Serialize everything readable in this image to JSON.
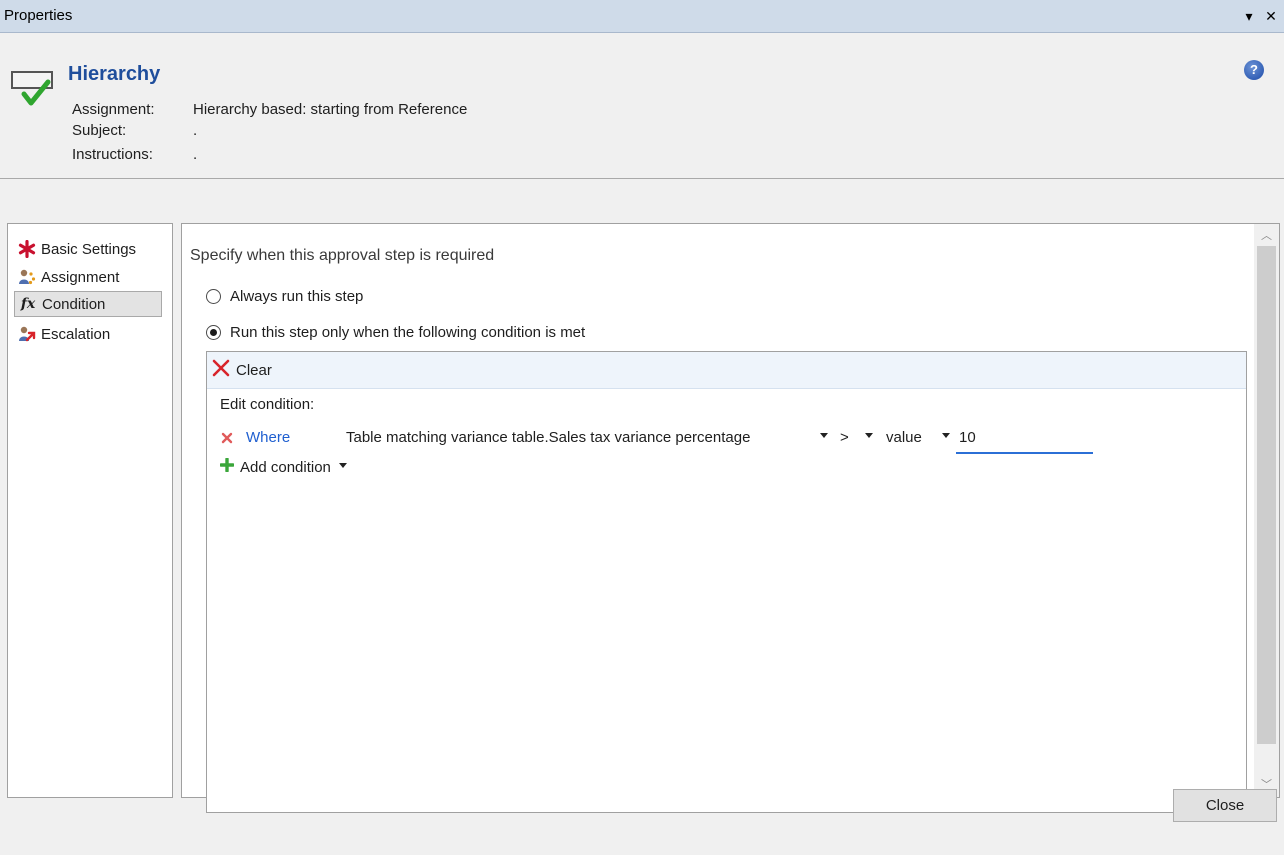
{
  "window": {
    "title": "Properties"
  },
  "header": {
    "title": "Hierarchy",
    "assignment_label": "Assignment:",
    "assignment_value": "Hierarchy based: starting from Reference",
    "subject_label": "Subject:",
    "subject_value": ".",
    "instructions_label": "Instructions:",
    "instructions_value": "."
  },
  "sidebar": {
    "items": [
      {
        "label": "Basic Settings",
        "icon": "asterisk-icon"
      },
      {
        "label": "Assignment",
        "icon": "users-icon"
      },
      {
        "label": "Condition",
        "icon": "function-icon",
        "selected": true
      },
      {
        "label": "Escalation",
        "icon": "escalation-icon"
      }
    ]
  },
  "condition": {
    "heading": "Specify when this approval step is required",
    "always_label": "Always run this step",
    "only_when_label": "Run this step only when the following condition is met",
    "selected_option": "only_when",
    "clear_label": "Clear",
    "edit_label": "Edit condition:",
    "row": {
      "where_label": "Where",
      "field": "Table matching variance table.Sales tax variance percentage",
      "operator": ">",
      "value_type": "value",
      "value": "10"
    },
    "add_label": "Add condition"
  },
  "footer": {
    "close_label": "Close"
  },
  "colors": {
    "accent": "#1f4e9c",
    "link": "#1f5fd0",
    "titlebar": "#cfdbe9"
  }
}
